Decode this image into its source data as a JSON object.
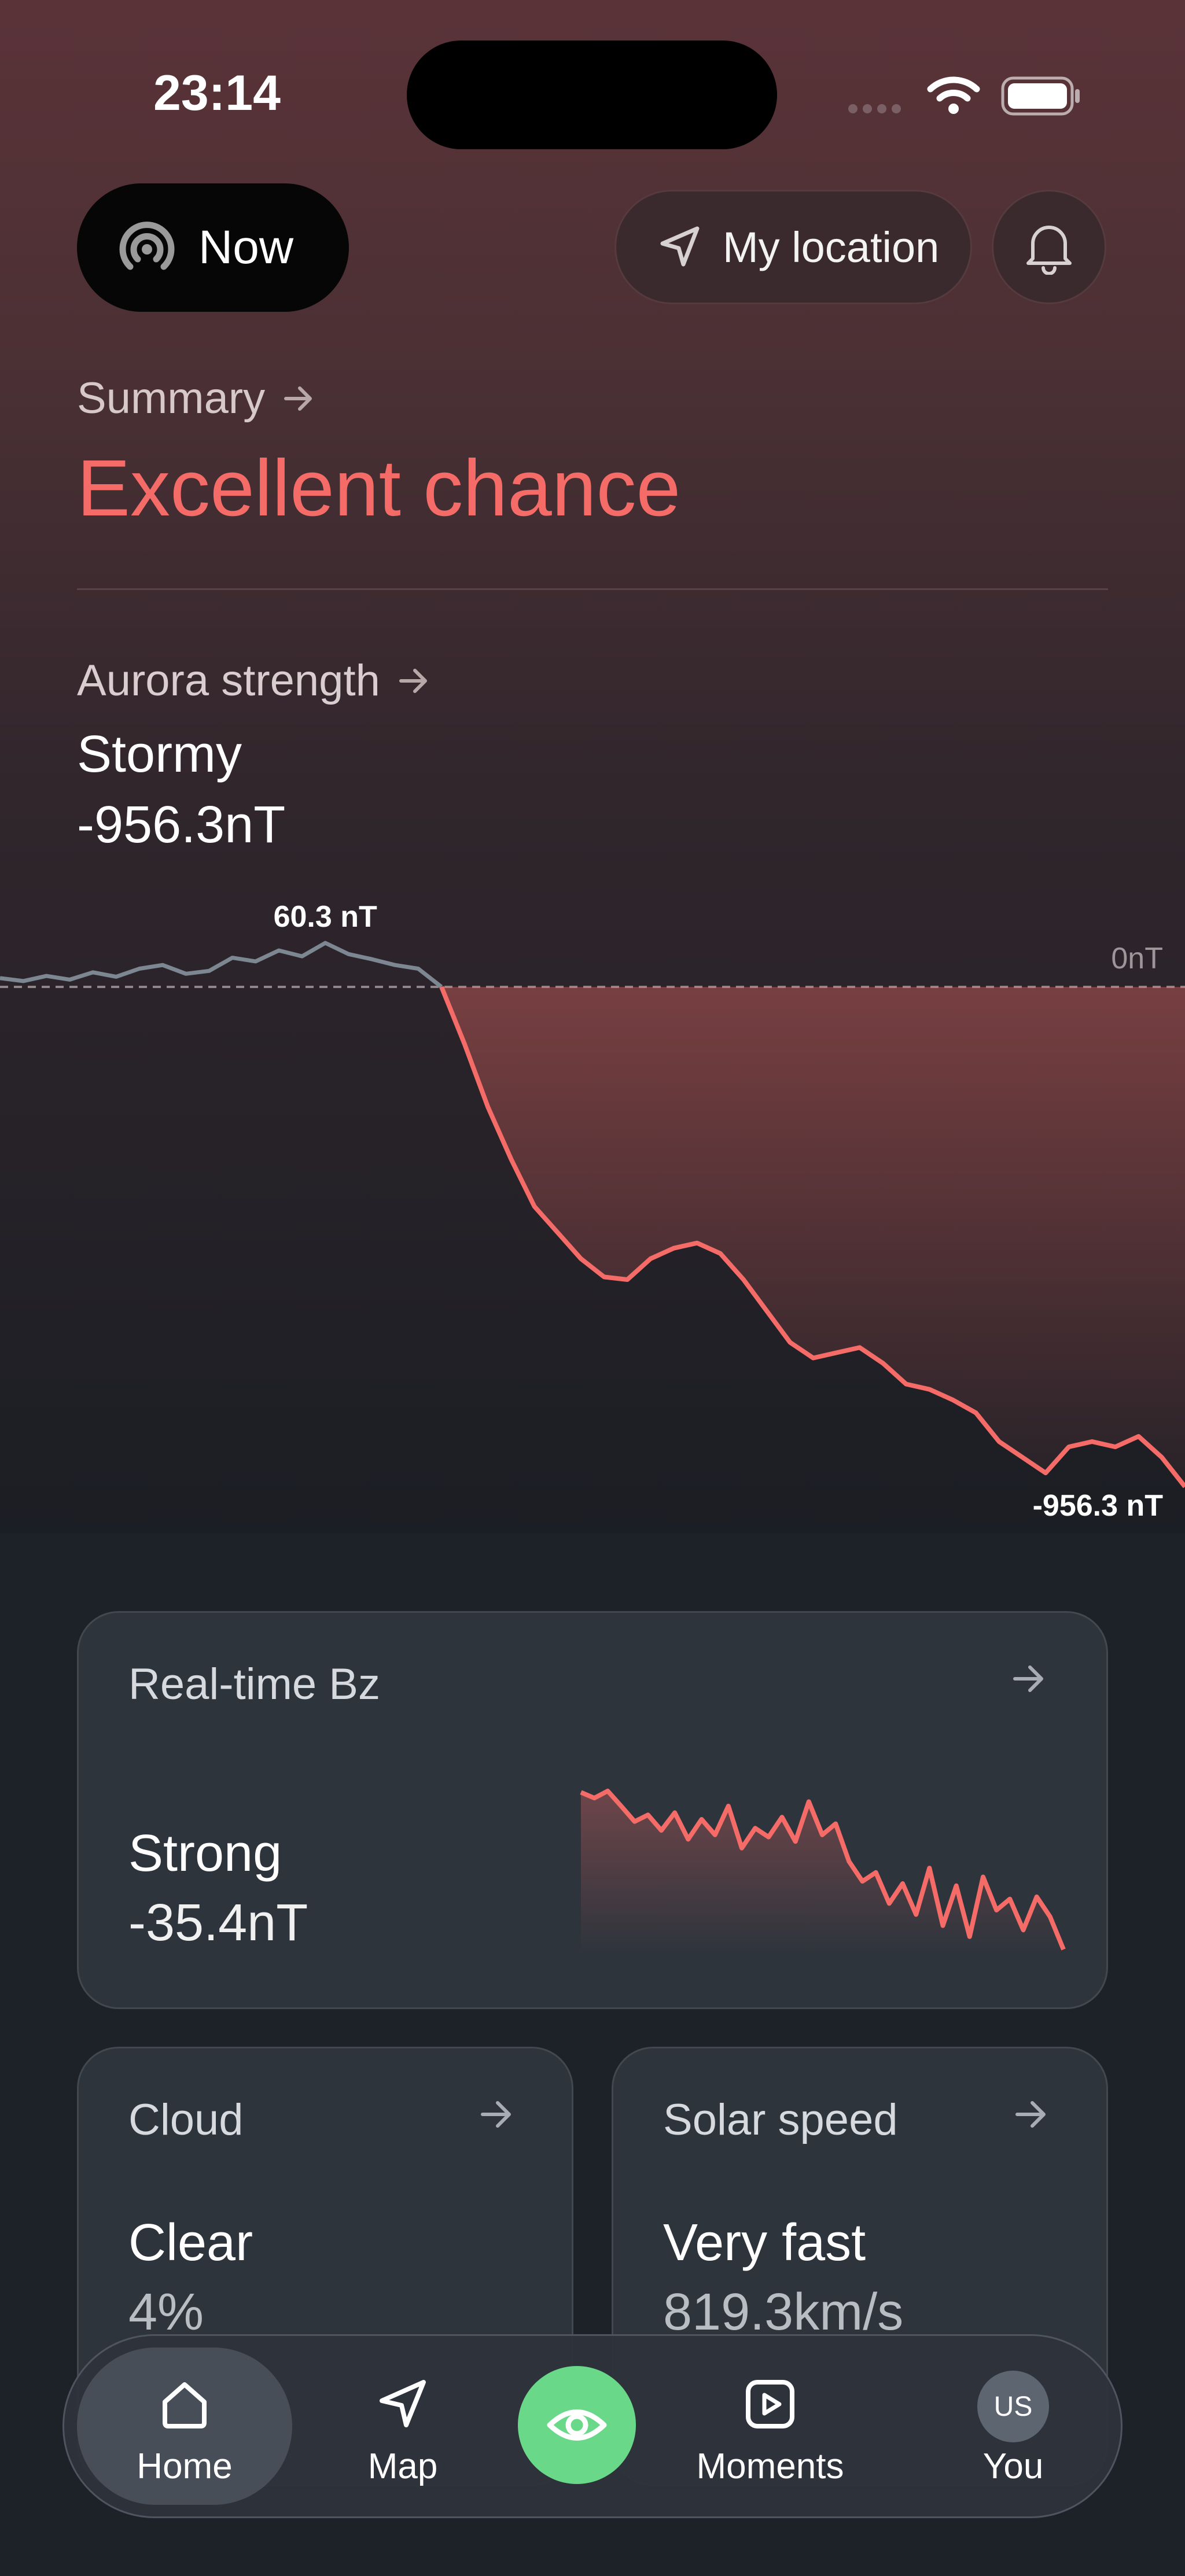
{
  "status_bar": {
    "time": "23:14"
  },
  "header": {
    "now_label": "Now",
    "location_label": "My location"
  },
  "summary": {
    "label": "Summary",
    "value": "Excellent chance"
  },
  "aurora_strength": {
    "label": "Aurora strength",
    "level": "Stormy",
    "value": "-956.3nT"
  },
  "colors": {
    "accent_red": "#f56b67",
    "accent_green": "#69d889",
    "zero_line": "#8e8688"
  },
  "chart_data": [
    {
      "type": "line",
      "title": "",
      "reference_label": "0nT",
      "max_label": "60.3 nT",
      "min_label": "-956.3 nT",
      "ylim": [
        -956.3,
        60.3
      ],
      "values": [
        12,
        8,
        15,
        10,
        20,
        14,
        25,
        30,
        18,
        22,
        40,
        35,
        50,
        42,
        60.3,
        45,
        38,
        30,
        25,
        0,
        -110,
        -230,
        -330,
        -420,
        -470,
        -520,
        -555,
        -560,
        -520,
        -500,
        -490,
        -510,
        -560,
        -620,
        -680,
        -710,
        -700,
        -690,
        -720,
        -760,
        -770,
        -790,
        -815,
        -870,
        -900,
        -930,
        -880,
        -870,
        -880,
        -860,
        -900,
        -956.3
      ]
    },
    {
      "type": "line",
      "title": "",
      "values": [
        0.1,
        -1.2,
        0.4,
        -3.0,
        -6.5,
        -5.0,
        -8.5,
        -4.5,
        -10.5,
        -6.0,
        -9.5,
        -3.0,
        -12.5,
        -8.0,
        -10.0,
        -5.5,
        -11.0,
        -2.0,
        -9.5,
        -7.0,
        -15.5,
        -20.0,
        -18.0,
        -25.0,
        -20.5,
        -27.5,
        -17.0,
        -30.0,
        -21.0,
        -32.5,
        -19.0,
        -26.5,
        -24.0,
        -31.0,
        -23.5,
        -28.0,
        -35.4
      ]
    }
  ],
  "cards": {
    "bz": {
      "title": "Real-time Bz",
      "level": "Strong",
      "value": "-35.4nT"
    },
    "cloud": {
      "title": "Cloud",
      "level": "Clear",
      "value": "4%"
    },
    "solar": {
      "title": "Solar speed",
      "level": "Very fast",
      "value": "819.3km/s"
    }
  },
  "tab_bar": {
    "home": "Home",
    "map": "Map",
    "moments": "Moments",
    "you": "You",
    "avatar_initials": "US",
    "active": "home"
  }
}
